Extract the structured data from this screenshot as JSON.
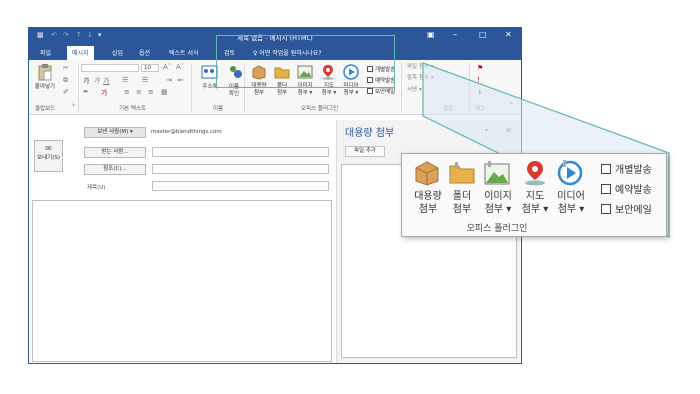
{
  "titlebar": {
    "title": "제목 없음 - 메시지 (HTML)",
    "quick_access": [
      "save-icon",
      "undo-icon",
      "redo-icon",
      "up-icon",
      "down-icon",
      "more-icon"
    ],
    "window_controls": [
      "ribbon-display-icon",
      "minimize-icon",
      "maximize-icon",
      "close-icon"
    ]
  },
  "tabs": {
    "items": [
      "파일",
      "메시지",
      "삽입",
      "옵션",
      "텍스트 서식",
      "검토"
    ],
    "active": "메시지",
    "tell_me": "♀ 어떤 작업을 원하시나요?"
  },
  "ribbon": {
    "paste": "붙여넣기",
    "clipboard": "클립보드",
    "font_size": "10",
    "basic_text": "기본 텍스트",
    "address_book": "주소록",
    "check_names": "이름 확인",
    "names": "이름",
    "office_plugin": "오피스 플러그인",
    "plugins": [
      {
        "label1": "대용량",
        "label2": "첨부",
        "icon": "box-icon"
      },
      {
        "label1": "폴더",
        "label2": "첨부",
        "icon": "folder-icon"
      },
      {
        "label1": "이미지",
        "label2": "첨부 ▾",
        "icon": "image-icon"
      },
      {
        "label1": "지도",
        "label2": "첨부 ▾",
        "icon": "map-pin-icon"
      },
      {
        "label1": "미디어",
        "label2": "첨부 ▾",
        "icon": "media-play-icon"
      }
    ],
    "checks": [
      "개별발송",
      "예약발송",
      "보안메일"
    ],
    "attach_file": "파일 첨부 ▾",
    "attach_item": "항목 첨부 ▾",
    "signature": "서명 ▾",
    "insert": "삽입",
    "tags": "태그"
  },
  "compose": {
    "from_button": "보낸 사람(M) ▾",
    "from_address": "master@blendthings.com",
    "send": "보내기(S)",
    "to_button": "받는 사람...",
    "cc_button": "참조(C)...",
    "subject_label": "제목(U)"
  },
  "pane": {
    "title": "대용량 첨부",
    "add_file": "파일 추가"
  },
  "colors": {
    "brand": "#2b579a",
    "highlight": "#5fb7b0"
  }
}
